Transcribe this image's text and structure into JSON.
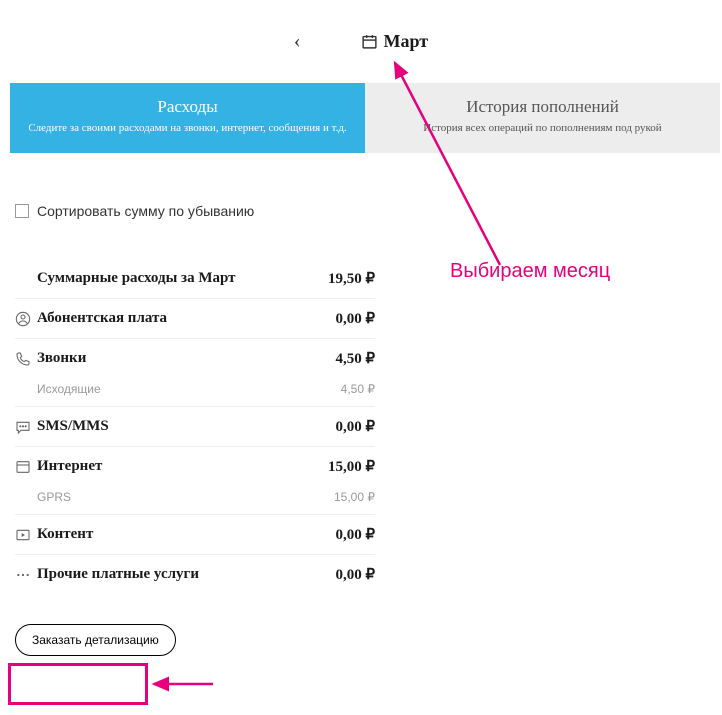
{
  "monthSelector": {
    "month": "Март"
  },
  "tabs": {
    "expenses": {
      "title": "Расходы",
      "subtitle": "Следите за своими расходами на звонки, интернет, сообщения и т.д."
    },
    "history": {
      "title": "История пополнений",
      "subtitle": "История всех операций по пополнениям под рукой"
    }
  },
  "sort": {
    "label": "Сортировать сумму по убыванию"
  },
  "summary": {
    "label": "Суммарные расходы за Март",
    "value": "19,50 ₽"
  },
  "rows": {
    "subscription": {
      "label": "Абонентская плата",
      "value": "0,00 ₽"
    },
    "calls": {
      "label": "Звонки",
      "value": "4,50 ₽",
      "sublabel": "Исходящие",
      "subvalue": "4,50 ₽"
    },
    "sms": {
      "label": "SMS/MMS",
      "value": "0,00 ₽"
    },
    "internet": {
      "label": "Интернет",
      "value": "15,00 ₽",
      "sublabel": "GPRS",
      "subvalue": "15,00 ₽"
    },
    "content": {
      "label": "Контент",
      "value": "0,00 ₽"
    },
    "other": {
      "label": "Прочие платные услуги",
      "value": "0,00 ₽"
    }
  },
  "orderButton": "Заказать детализацию",
  "annotation": "Выбираем месяц"
}
